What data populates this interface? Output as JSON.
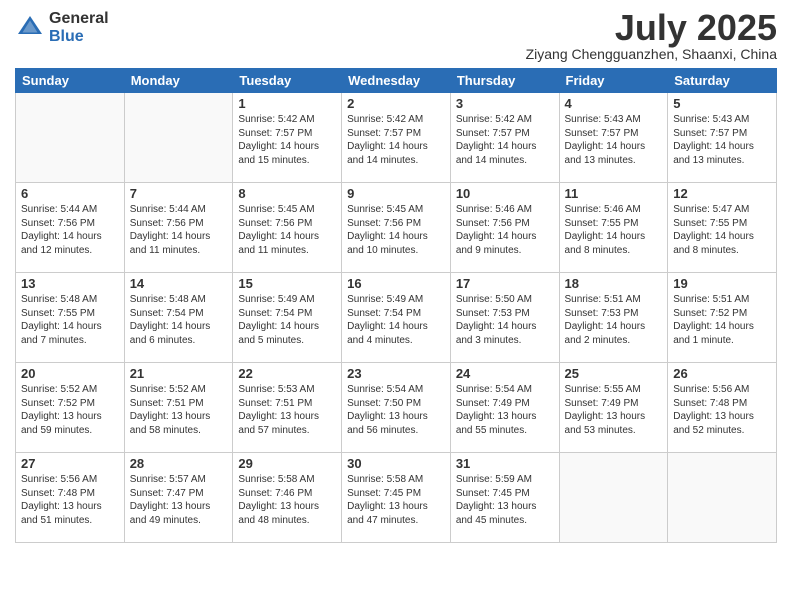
{
  "header": {
    "logo_general": "General",
    "logo_blue": "Blue",
    "month": "July 2025",
    "location": "Ziyang Chengguanzhen, Shaanxi, China"
  },
  "days_of_week": [
    "Sunday",
    "Monday",
    "Tuesday",
    "Wednesday",
    "Thursday",
    "Friday",
    "Saturday"
  ],
  "weeks": [
    [
      {
        "day": "",
        "info": ""
      },
      {
        "day": "",
        "info": ""
      },
      {
        "day": "1",
        "info": "Sunrise: 5:42 AM\nSunset: 7:57 PM\nDaylight: 14 hours and 15 minutes."
      },
      {
        "day": "2",
        "info": "Sunrise: 5:42 AM\nSunset: 7:57 PM\nDaylight: 14 hours and 14 minutes."
      },
      {
        "day": "3",
        "info": "Sunrise: 5:42 AM\nSunset: 7:57 PM\nDaylight: 14 hours and 14 minutes."
      },
      {
        "day": "4",
        "info": "Sunrise: 5:43 AM\nSunset: 7:57 PM\nDaylight: 14 hours and 13 minutes."
      },
      {
        "day": "5",
        "info": "Sunrise: 5:43 AM\nSunset: 7:57 PM\nDaylight: 14 hours and 13 minutes."
      }
    ],
    [
      {
        "day": "6",
        "info": "Sunrise: 5:44 AM\nSunset: 7:56 PM\nDaylight: 14 hours and 12 minutes."
      },
      {
        "day": "7",
        "info": "Sunrise: 5:44 AM\nSunset: 7:56 PM\nDaylight: 14 hours and 11 minutes."
      },
      {
        "day": "8",
        "info": "Sunrise: 5:45 AM\nSunset: 7:56 PM\nDaylight: 14 hours and 11 minutes."
      },
      {
        "day": "9",
        "info": "Sunrise: 5:45 AM\nSunset: 7:56 PM\nDaylight: 14 hours and 10 minutes."
      },
      {
        "day": "10",
        "info": "Sunrise: 5:46 AM\nSunset: 7:56 PM\nDaylight: 14 hours and 9 minutes."
      },
      {
        "day": "11",
        "info": "Sunrise: 5:46 AM\nSunset: 7:55 PM\nDaylight: 14 hours and 8 minutes."
      },
      {
        "day": "12",
        "info": "Sunrise: 5:47 AM\nSunset: 7:55 PM\nDaylight: 14 hours and 8 minutes."
      }
    ],
    [
      {
        "day": "13",
        "info": "Sunrise: 5:48 AM\nSunset: 7:55 PM\nDaylight: 14 hours and 7 minutes."
      },
      {
        "day": "14",
        "info": "Sunrise: 5:48 AM\nSunset: 7:54 PM\nDaylight: 14 hours and 6 minutes."
      },
      {
        "day": "15",
        "info": "Sunrise: 5:49 AM\nSunset: 7:54 PM\nDaylight: 14 hours and 5 minutes."
      },
      {
        "day": "16",
        "info": "Sunrise: 5:49 AM\nSunset: 7:54 PM\nDaylight: 14 hours and 4 minutes."
      },
      {
        "day": "17",
        "info": "Sunrise: 5:50 AM\nSunset: 7:53 PM\nDaylight: 14 hours and 3 minutes."
      },
      {
        "day": "18",
        "info": "Sunrise: 5:51 AM\nSunset: 7:53 PM\nDaylight: 14 hours and 2 minutes."
      },
      {
        "day": "19",
        "info": "Sunrise: 5:51 AM\nSunset: 7:52 PM\nDaylight: 14 hours and 1 minute."
      }
    ],
    [
      {
        "day": "20",
        "info": "Sunrise: 5:52 AM\nSunset: 7:52 PM\nDaylight: 13 hours and 59 minutes."
      },
      {
        "day": "21",
        "info": "Sunrise: 5:52 AM\nSunset: 7:51 PM\nDaylight: 13 hours and 58 minutes."
      },
      {
        "day": "22",
        "info": "Sunrise: 5:53 AM\nSunset: 7:51 PM\nDaylight: 13 hours and 57 minutes."
      },
      {
        "day": "23",
        "info": "Sunrise: 5:54 AM\nSunset: 7:50 PM\nDaylight: 13 hours and 56 minutes."
      },
      {
        "day": "24",
        "info": "Sunrise: 5:54 AM\nSunset: 7:49 PM\nDaylight: 13 hours and 55 minutes."
      },
      {
        "day": "25",
        "info": "Sunrise: 5:55 AM\nSunset: 7:49 PM\nDaylight: 13 hours and 53 minutes."
      },
      {
        "day": "26",
        "info": "Sunrise: 5:56 AM\nSunset: 7:48 PM\nDaylight: 13 hours and 52 minutes."
      }
    ],
    [
      {
        "day": "27",
        "info": "Sunrise: 5:56 AM\nSunset: 7:48 PM\nDaylight: 13 hours and 51 minutes."
      },
      {
        "day": "28",
        "info": "Sunrise: 5:57 AM\nSunset: 7:47 PM\nDaylight: 13 hours and 49 minutes."
      },
      {
        "day": "29",
        "info": "Sunrise: 5:58 AM\nSunset: 7:46 PM\nDaylight: 13 hours and 48 minutes."
      },
      {
        "day": "30",
        "info": "Sunrise: 5:58 AM\nSunset: 7:45 PM\nDaylight: 13 hours and 47 minutes."
      },
      {
        "day": "31",
        "info": "Sunrise: 5:59 AM\nSunset: 7:45 PM\nDaylight: 13 hours and 45 minutes."
      },
      {
        "day": "",
        "info": ""
      },
      {
        "day": "",
        "info": ""
      }
    ]
  ]
}
